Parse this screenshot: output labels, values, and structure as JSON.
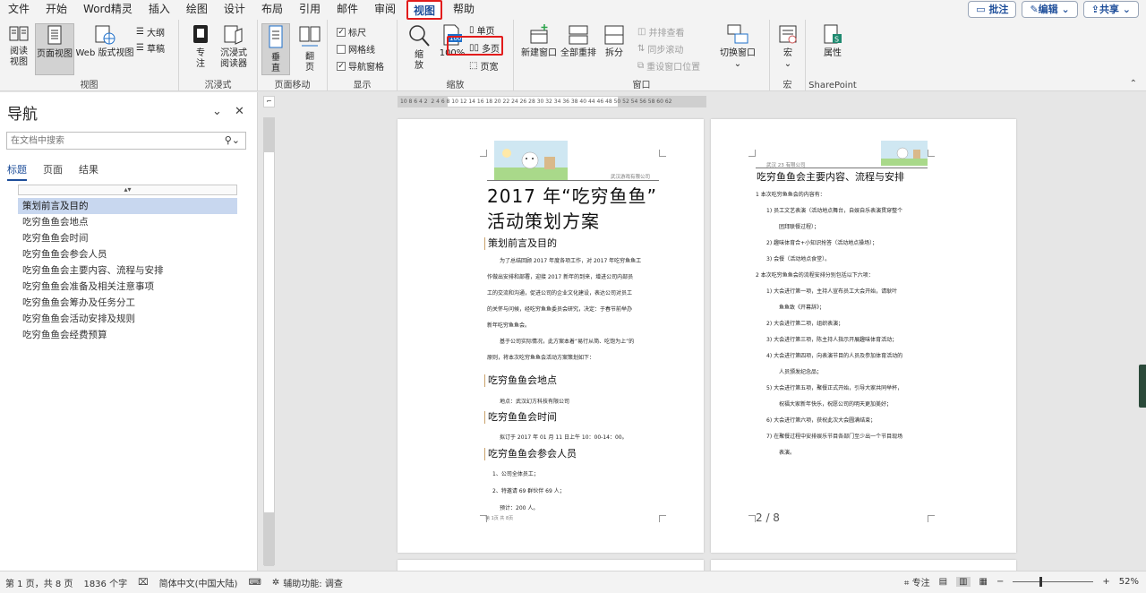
{
  "menu": {
    "tabs": [
      "文件",
      "开始",
      "Word精灵",
      "插入",
      "绘图",
      "设计",
      "布局",
      "引用",
      "邮件",
      "审阅",
      "视图",
      "帮助"
    ],
    "active": "视图",
    "comment": "批注",
    "edit": "编辑",
    "share": "共享"
  },
  "ribbon": {
    "views": {
      "read": "阅读视图",
      "print": "页面视图",
      "web": "Web 版式视图",
      "outline": "大纲",
      "draft": "草稿",
      "label": "视图"
    },
    "immersive": {
      "focus": "专注",
      "reader": "沉浸式阅读器",
      "label": "沉浸式"
    },
    "movement": {
      "vertical": "垂直",
      "side": "翻页",
      "label": "页面移动"
    },
    "show": {
      "ruler": "标尺",
      "gridlines": "网格线",
      "navpane": "导航窗格",
      "label": "显示"
    },
    "zoom": {
      "zoom": "缩放",
      "pct": "100%",
      "one": "单页",
      "multi": "多页",
      "width": "页宽",
      "label": "缩放"
    },
    "window": {
      "new": "新建窗口",
      "arrange": "全部重排",
      "split": "拆分",
      "side": "并排查看",
      "sync": "同步滚动",
      "reset": "重设窗口位置",
      "switch": "切换窗口",
      "label": "窗口"
    },
    "macros": {
      "macro": "宏",
      "label": "宏"
    },
    "sp": {
      "props": "属性",
      "label": "SharePoint"
    }
  },
  "nav": {
    "title": "导航",
    "search_placeholder": "在文档中搜索",
    "tabs": [
      "标题",
      "页面",
      "结果"
    ],
    "items": [
      "策划前言及目的",
      "吃穷鱼鱼会地点",
      "吃穷鱼鱼会时间",
      "吃穷鱼鱼会参会人员",
      "吃穷鱼鱼会主要内容、流程与安排",
      "吃穷鱼鱼会准备及相关注意事项",
      "吃穷鱼鱼会筹办及任务分工",
      "吃穷鱼鱼会活动安排及规则",
      "吃穷鱼鱼会经费预算"
    ]
  },
  "ruler": {
    "left": "10 8 6 4 2",
    "mid": "2 4 6 8 10 12 14 16 18 20 22 24 26 28 30 32 34 36 38 40",
    "right": "44 46 48 50 52 54 56 58 60 62"
  },
  "page1": {
    "company": "武汉游戏有限公司",
    "title1": "2017 年“吃穷鱼鱼”",
    "title2": "活动策划方案",
    "h_intro": "策划前言及目的",
    "p1": [
      "为了总结回顾 2017 年度各项工作，对 2017 年吃穷鱼鱼工",
      "作做出安排和部署，迎接 2017 新年的到来，增进公司内部员",
      "工的交流和沟通，促进公司的企业文化建设，表达公司对员工",
      "的关怀与问候，经吃穷鱼鱼委员会研究，决定：于春节前举办",
      "新年吃穷鱼鱼会。"
    ],
    "p2": [
      "基于公司实际情况，此方案本着“易行从简、吃饱为上”的",
      "原则，将本次吃穷鱼鱼会活动方案策划如下："
    ],
    "h_place": "吃穷鱼鱼会地点",
    "place": "地点：武汉幻方科技有限公司",
    "h_time": "吃穷鱼鱼会时间",
    "time": "拟订于 2017 年 01 月 11 日上午 10：00-14：00。",
    "h_people": "吃穷鱼鱼会参会人员",
    "people": [
      "1、公司全体员工；",
      "2、特邀请 69 群伙伴 69 人；",
      "预计：200 人。"
    ],
    "footer": "第 1页 共 8页"
  },
  "page2": {
    "company": "武汉 23 有限公司",
    "heading": "吃穷鱼鱼会主要内容、流程与安排",
    "lines": [
      "1    本次吃穷鱼鱼会的内容有：",
      "1)    员工文艺表演（活动地点舞台，自娱自乐表演贯穿整个",
      "团拜联餐过程）；",
      "2)    趣味体育合+小知识抢答（活动地点操场）；",
      "3)    会餐（活动地点食堂）。",
      "2    本次吃穷鱼鱼会的流程安排分别包括以下六项：",
      "1)    大会进行第一项，主持人宣布员工大会开始，请耿叶",
      "鱼鱼致《开幕辞》；",
      "2)    大会进行第二项，组织表演；",
      "3)    大会进行第三项，陈主持人指示开展趣味体育活动；",
      "4)    大会进行第四项，向表演节目的人员及参加体育活动的",
      "人员颁发纪念品；",
      "5)    大会进行第五项，聚餐正式开始，引导大家共同举杯，",
      "祝福大家新年快乐，祝愿公司的明天更加美好；",
      "6)    大会进行第六项，获祝此次大会圆满结束；",
      "7)    在聚餐过程中安排娱乐节目各部门至少出一个节目现场",
      "表演。"
    ],
    "pgnum": "2 / 8"
  },
  "status": {
    "page": "第 1 页，共 8 页",
    "words": "1836 个字",
    "lang": "简体中文(中国大陆)",
    "access": "辅助功能: 调查",
    "focus": "专注",
    "zoom": "52%"
  }
}
